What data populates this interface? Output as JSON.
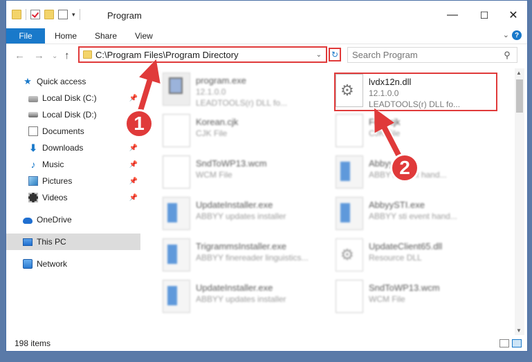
{
  "window": {
    "title": "Program",
    "controls": {
      "minimize": "—",
      "maximize": "☐",
      "close": "✕"
    }
  },
  "ribbon": {
    "file": "File",
    "tabs": [
      "Home",
      "Share",
      "View"
    ]
  },
  "nav": {
    "address": "C:\\Program Files\\Program Directory",
    "search_placeholder": "Search Program"
  },
  "sidebar": {
    "items": [
      {
        "label": "Quick access",
        "icon": "star-icon"
      },
      {
        "label": "Local Disk (C:)",
        "icon": "disk-icon"
      },
      {
        "label": "Local Disk (D:)",
        "icon": "disk-icon"
      },
      {
        "label": "Documents",
        "icon": "documents-icon"
      },
      {
        "label": "Downloads",
        "icon": "downloads-icon"
      },
      {
        "label": "Music",
        "icon": "music-icon"
      },
      {
        "label": "Pictures",
        "icon": "pictures-icon"
      },
      {
        "label": "Videos",
        "icon": "videos-icon"
      },
      {
        "label": "OneDrive",
        "icon": "cloud-icon"
      },
      {
        "label": "This PC",
        "icon": "pc-icon"
      },
      {
        "label": "Network",
        "icon": "network-icon"
      }
    ]
  },
  "files": [
    {
      "name": "program.exe",
      "sub1": "12.1.0.0",
      "sub2": "LEADTOOLS(r) DLL fo...",
      "thumb": "exe"
    },
    {
      "name": "lvdx12n.dll",
      "sub1": "12.1.0.0",
      "sub2": "LEADTOOLS(r) DLL fo...",
      "thumb": "gear"
    },
    {
      "name": "Korean.cjk",
      "sub1": "CJK File",
      "thumb": "blank"
    },
    {
      "name": "Font.cjk",
      "sub1": "CJK File",
      "thumb": "blank"
    },
    {
      "name": "SndToWP13.wcm",
      "sub1": "WCM File",
      "thumb": "blank"
    },
    {
      "name": "AbbyyWave",
      "sub1": "ABBYY event hand...",
      "thumb": "app"
    },
    {
      "name": "UpdateInstaller.exe",
      "sub1": "ABBYY updates installer",
      "thumb": "app"
    },
    {
      "name": "AbbyySTI.exe",
      "sub1": "ABBYY sti event hand...",
      "thumb": "app"
    },
    {
      "name": "TrigrammsInstaller.exe",
      "sub1": "ABBYY finereader linguistics...",
      "thumb": "app"
    },
    {
      "name": "UpdateClient65.dll",
      "sub1": "Resource DLL",
      "thumb": "gear"
    },
    {
      "name": "UpdateInstaller.exe",
      "sub1": "ABBYY updates installer",
      "thumb": "app"
    },
    {
      "name": "SndToWP13.wcm",
      "sub1": "WCM File",
      "thumb": "blank"
    }
  ],
  "status": {
    "item_count": "198 items"
  },
  "annotations": {
    "badge1": "1",
    "badge2": "2",
    "accent": "#e03a3a"
  }
}
